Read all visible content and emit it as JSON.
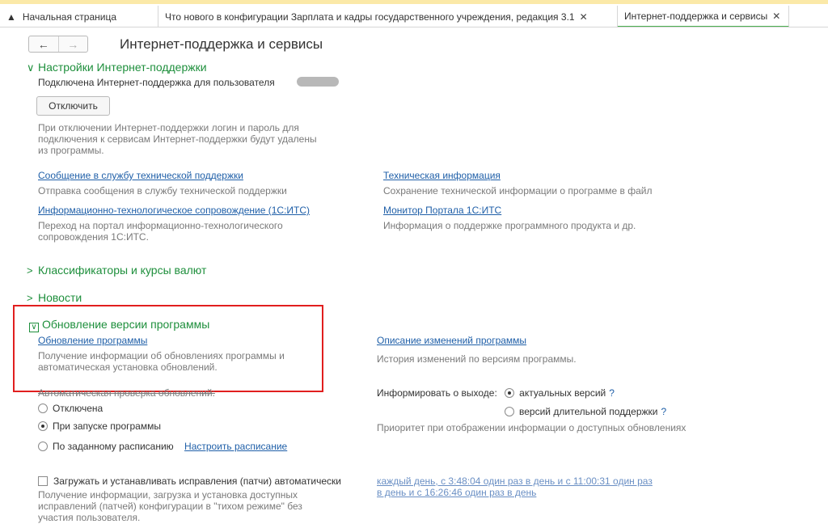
{
  "tabs": [
    {
      "label": "Начальная страница"
    },
    {
      "label": "Что нового в конфигурации Зарплата и кадры государственного учреждения, редакция 3.1"
    },
    {
      "label": "Интернет-поддержка и сервисы"
    }
  ],
  "page_title": "Интернет-поддержка и сервисы",
  "support_settings": {
    "title": "Настройки Интернет-поддержки",
    "connected_text": "Подключена Интернет-поддержка для пользователя",
    "disconnect_label": "Отключить",
    "disconnect_note": "При отключении Интернет-поддержки логин и пароль для подключения к сервисам Интернет-поддержки будут удалены из программы.",
    "links": [
      {
        "label": "Сообщение в службу технической поддержки",
        "desc": "Отправка сообщения в службу технической поддержки"
      },
      {
        "label": "Техническая информация",
        "desc": "Сохранение технической информации о программе в файл"
      },
      {
        "label": "Информационно-технологическое сопровождение (1С:ИТС)",
        "desc": "Переход на портал информационно-технологического сопровождения 1С:ИТС."
      },
      {
        "label": "Монитор Портала 1С:ИТС",
        "desc": "Информация о поддержке программного продукта и др."
      }
    ]
  },
  "sections": {
    "classifiers": "Классификаторы и курсы валют",
    "news": "Новости",
    "update": "Обновление версии программы"
  },
  "update": {
    "program_update_link": "Обновление программы",
    "program_update_desc": "Получение информации об обновлениях программы и автоматическая установка обновлений.",
    "changes_link": "Описание изменений программы",
    "changes_desc": "История изменений по версиям программы.",
    "auto_check_label": "Автоматическая проверка обновлений:",
    "auto_check_options": [
      {
        "label": "Отключена",
        "selected": false
      },
      {
        "label": "При запуске программы",
        "selected": true
      },
      {
        "label": "По заданному расписанию",
        "selected": false
      }
    ],
    "schedule_link": "Настроить расписание",
    "inform_label": "Информировать о выходе:",
    "inform_options": [
      {
        "label": "актуальных версий",
        "selected": true
      },
      {
        "label": "версий длительной поддержки",
        "selected": false
      }
    ],
    "question_mark": "?",
    "priority_note": "Приоритет при отображении информации о доступных обновлениях",
    "patches_label": "Загружать и устанавливать исправления (патчи) автоматически",
    "patches_checked": false,
    "patches_schedule_link": "каждый день, с 3:48:04 один раз в день и с 11:00:31 один раз в день и с 16:26:46 один раз в день",
    "patches_desc": "Получение информации, загрузка и установка доступных исправлений (патчей) конфигурации в \"тихом режиме\" без участия пользователя."
  },
  "colors": {
    "section_title": "#1e8f3c",
    "link": "#1f5fa8",
    "highlight_box": "#e11f1f"
  }
}
